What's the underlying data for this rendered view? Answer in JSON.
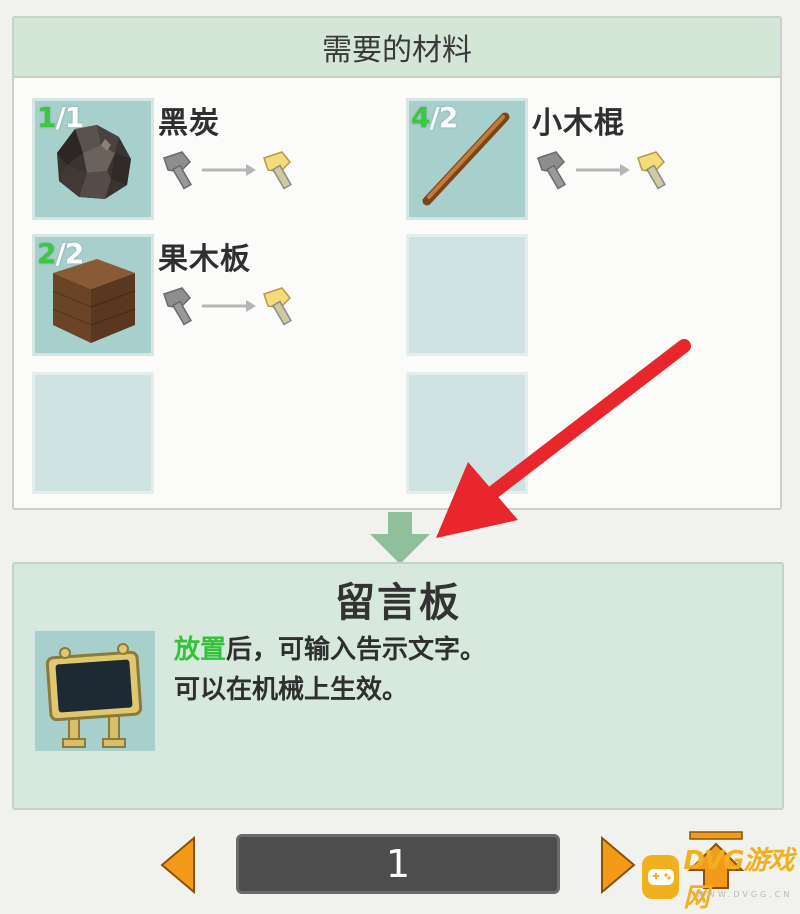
{
  "materials_panel": {
    "title": "需要的材料",
    "items": [
      {
        "name": "黑炭",
        "have": "1",
        "need": "/1"
      },
      {
        "name": "小木棍",
        "have": "4",
        "need": "/2"
      },
      {
        "name": "果木板",
        "have": "2",
        "need": "/2"
      }
    ]
  },
  "result": {
    "title": "留言板",
    "desc_highlight": "放置",
    "desc_line1_rest": "后，可输入告示文字。",
    "desc_line2": "可以在机械上生效。"
  },
  "pagination": {
    "page": "1"
  },
  "watermark": {
    "text": "DVG游戏网",
    "sub": "WWW.DVGG.CN"
  },
  "colors": {
    "have_count": "#3cc83c",
    "highlight": "#34c23a",
    "arrow_red": "#e8262c",
    "nav_orange": "#f39a1a",
    "header_bg": "#d4e6d6"
  },
  "icons": [
    "charcoal-icon",
    "stick-icon",
    "wood-plank-icon",
    "axe-gray-icon",
    "axe-gold-icon",
    "signboard-icon",
    "prev-page-icon",
    "next-page-icon",
    "to-top-icon"
  ]
}
